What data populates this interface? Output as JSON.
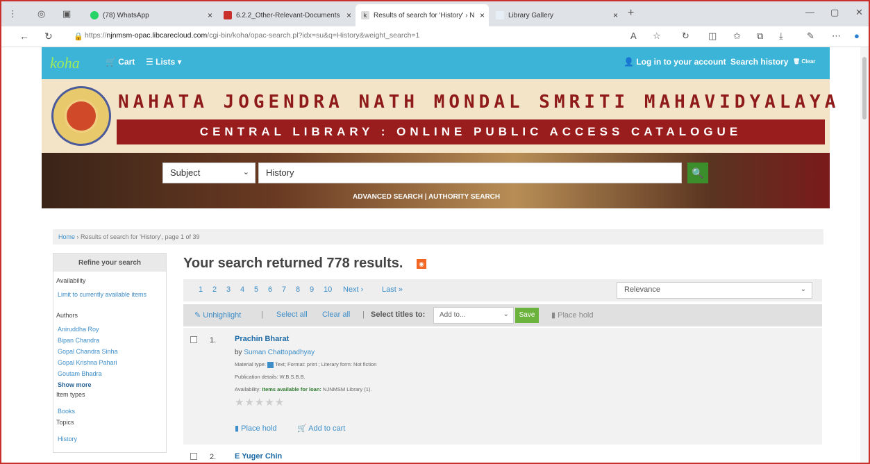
{
  "browser": {
    "tabs": [
      {
        "label": "(78) WhatsApp"
      },
      {
        "label": "6.2.2_Other-Relevant-Documents"
      },
      {
        "label": "Results of search for 'History' › N"
      },
      {
        "label": "Library Gallery"
      }
    ],
    "url_prefix": "https://",
    "url_host": "njnmsm-opac.libcarecloud.com",
    "url_path": "/cgi-bin/koha/opac-search.pl?idx=su&q=History&weight_search=1"
  },
  "navbar": {
    "logo": "koha",
    "cart": "Cart",
    "lists": "Lists ▾",
    "login": "Log in to your account",
    "history": "Search history",
    "clear": "Clear"
  },
  "banner": {
    "college": "NAHATA JOGENDRA NATH MONDAL SMRITI MAHAVIDYALAYA",
    "library": "CENTRAL LIBRARY : ONLINE PUBLIC ACCESS CATALOGUE"
  },
  "search": {
    "index": "Subject",
    "query": "History",
    "advanced": "ADVANCED SEARCH",
    "sep": "|",
    "authority": "AUTHORITY SEARCH"
  },
  "breadcrumb": {
    "home": "Home",
    "current": "Results of search for 'History', page 1 of 39"
  },
  "refine": {
    "title": "Refine your search",
    "availability": "Availability",
    "limit": "Limit to currently available items",
    "authors": "Authors",
    "author_list": [
      "Aniruddha Roy",
      "Bipan Chandra",
      "Gopal Chandra Sinha",
      "Gopal Krishna Pahari",
      "Goutam Bhadra"
    ],
    "show_more": "Show more",
    "item_types": "Item types",
    "books": "Books",
    "topics": "Topics",
    "history": "History"
  },
  "results": {
    "heading": "Your search returned 778 results.",
    "pages": [
      "1",
      "2",
      "3",
      "4",
      "5",
      "6",
      "7",
      "8",
      "9",
      "10"
    ],
    "next": "Next ›",
    "last": "Last »",
    "sort": "Relevance"
  },
  "toolbar": {
    "unhighlight": "Unhighlight",
    "select_all": "Select all",
    "clear_all": "Clear all",
    "select_titles": "Select titles to:",
    "add_to": "Add to...",
    "save": "Save",
    "place_hold": "Place hold"
  },
  "items": [
    {
      "num": "1.",
      "title": "Prachin Bharat",
      "by": "by",
      "author": "Suman Chattopadhyay",
      "material": "Material type:",
      "material_value": "Text; Format: print ; Literary form: Not fiction",
      "publication": "Publication details: W.B.S.B.B.",
      "availability": "Availability:",
      "avail_value": "Items available for loan:",
      "avail_lib": "NJNMSM Library (1).",
      "place_hold": "Place hold",
      "add_cart": "Add to cart"
    },
    {
      "num": "2.",
      "title": "E Yuger Chin"
    }
  ]
}
